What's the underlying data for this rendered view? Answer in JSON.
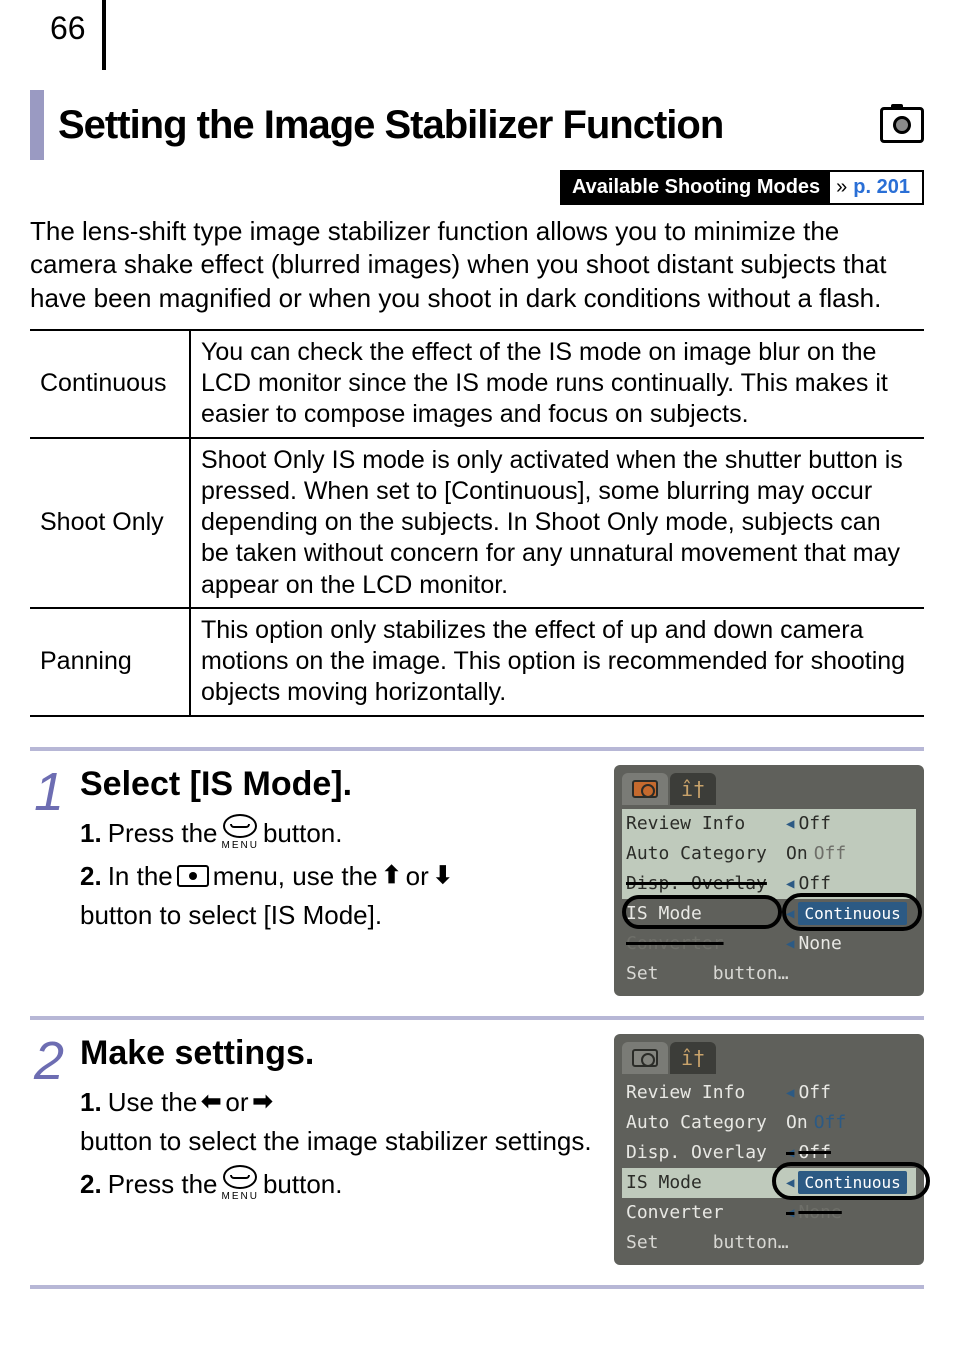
{
  "page_number": "66",
  "title": "Setting the Image Stabilizer Function",
  "modes_box": {
    "label": "Available Shooting Modes",
    "link": "p. 201"
  },
  "intro": "The lens-shift type image stabilizer function allows you to minimize the camera shake effect (blurred images) when you shoot distant subjects that have been magnified or when you shoot in dark conditions without a flash.",
  "table": {
    "rows": [
      {
        "label": "Continuous",
        "desc": "You can check the effect of the IS mode on image blur on the LCD monitor since the IS mode runs continually. This makes it easier to compose images and focus on subjects."
      },
      {
        "label": "Shoot Only",
        "desc": "Shoot Only IS mode is only activated when the shutter button is pressed. When set to [Continuous], some blurring may occur depending on the subjects. In Shoot Only mode, subjects can be taken without concern for any unnatural movement that may appear on the LCD monitor."
      },
      {
        "label": "Panning",
        "desc": "This option only stabilizes the effect of up and down camera motions on the image. This option is recommended for shooting objects moving horizontally."
      }
    ]
  },
  "steps": [
    {
      "num": "1",
      "heading": "Select [IS Mode].",
      "lines": {
        "l1a": "1.",
        "l1b": "Press the ",
        "l1c": " button.",
        "l2a": "2.",
        "l2b": "In the ",
        "l2c": " menu, use the ",
        "l2d": " or ",
        "l2e": " button to select [IS Mode]."
      },
      "lcd": {
        "rows": [
          {
            "l": "Review Info",
            "v": "Off",
            "hl": true
          },
          {
            "l": "Auto Category",
            "v_on": "On",
            "v_off": "Off",
            "hl": true
          },
          {
            "l": "Disp. Overlay",
            "v": "Off",
            "hl": true,
            "strike": true
          },
          {
            "l": "IS Mode",
            "v_tag": "Continuous"
          },
          {
            "l": "Converter",
            "v": "None",
            "strike": true
          }
        ],
        "set": "Set     button…"
      }
    },
    {
      "num": "2",
      "heading": "Make settings.",
      "lines": {
        "l1a": "1.",
        "l1b": "Use the ",
        "l1c": " or ",
        "l1d": " button to select the image stabilizer settings.",
        "l2a": "2.",
        "l2b": "Press the ",
        "l2c": " button."
      },
      "lcd": {
        "rows": [
          {
            "l": "Review Info",
            "v": "Off"
          },
          {
            "l": "Auto Category",
            "v_on": "On",
            "v_off": "Off"
          },
          {
            "l": "Disp. Overlay",
            "v": "Off",
            "strike": true
          },
          {
            "l": "IS Mode",
            "v_tag": "Continuous",
            "hl": true
          },
          {
            "l": "Converter",
            "v": "None",
            "strike": true
          }
        ],
        "set": "Set     button…"
      }
    }
  ],
  "glyphs": {
    "chevrons": "»",
    "up": "⬆",
    "down": "⬇",
    "left": "⬅",
    "right": "➡",
    "tri_l": "◀",
    "tri_r": "▶",
    "menu_label": "MENU",
    "tools": "î†"
  }
}
